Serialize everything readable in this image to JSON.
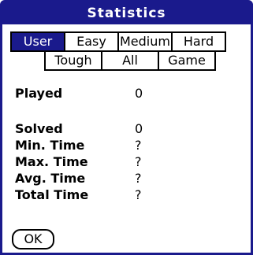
{
  "window": {
    "title": "Statistics"
  },
  "tabs": {
    "row1": [
      {
        "label": "User",
        "selected": true
      },
      {
        "label": "Easy",
        "selected": false
      },
      {
        "label": "Medium",
        "selected": false
      },
      {
        "label": "Hard",
        "selected": false
      }
    ],
    "row2": [
      {
        "label": "Tough",
        "selected": false
      },
      {
        "label": "All",
        "selected": false
      },
      {
        "label": "Game",
        "selected": false
      }
    ]
  },
  "stats": [
    {
      "label": "Played",
      "value": "0"
    },
    {
      "label": "Solved",
      "value": "0"
    },
    {
      "label": "Min. Time",
      "value": "?"
    },
    {
      "label": "Max. Time",
      "value": "?"
    },
    {
      "label": "Avg. Time",
      "value": "?"
    },
    {
      "label": "Total Time",
      "value": "?"
    }
  ],
  "buttons": {
    "ok_label": "OK"
  },
  "colors": {
    "accent": "#1a1a8c",
    "background": "#ffffff",
    "text": "#000000"
  }
}
